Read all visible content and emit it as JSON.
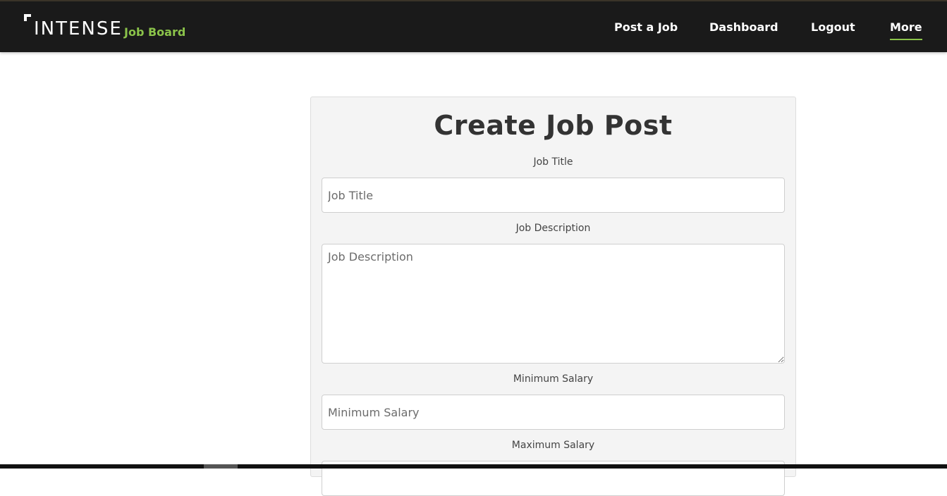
{
  "header": {
    "logo_text": "INTENSE",
    "logo_subtext": "Job Board",
    "nav": [
      {
        "label": "Post a Job"
      },
      {
        "label": "Dashboard"
      },
      {
        "label": "Logout"
      },
      {
        "label": "More",
        "active": true
      }
    ]
  },
  "form": {
    "title": "Create Job Post",
    "fields": {
      "job_title": {
        "label": "Job Title",
        "placeholder": "Job Title",
        "value": ""
      },
      "job_description": {
        "label": "Job Description",
        "placeholder": "Job Description",
        "value": ""
      },
      "min_salary": {
        "label": "Minimum Salary",
        "placeholder": "Minimum Salary",
        "value": ""
      },
      "max_salary": {
        "label": "Maximum Salary",
        "placeholder": "",
        "value": ""
      }
    }
  },
  "colors": {
    "header_bg": "#1a1a1a",
    "accent": "#8bc34a",
    "card_bg": "#f4f4f4"
  }
}
